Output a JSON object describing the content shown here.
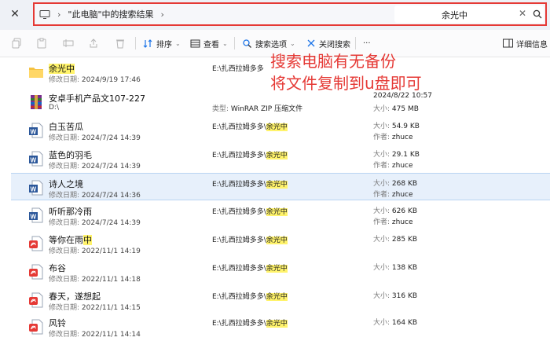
{
  "window": {
    "close_glyph": "✕"
  },
  "address": {
    "location": "\"此电脑\"中的搜索结果",
    "chevron": "›",
    "search_value": "余光中",
    "clear_glyph": "✕"
  },
  "toolbar": {
    "sort_label": "排序",
    "view_label": "查看",
    "search_options_label": "搜索选项",
    "close_search_label": "关闭搜索",
    "more_label": "···",
    "details_label": "详细信息"
  },
  "annotation": {
    "line1": "搜索电脑有无备份",
    "line2": "将文件复制到u盘即可"
  },
  "files": [
    {
      "kind": "folder",
      "name_pre": "",
      "name_hl": "余光中",
      "name_post": "",
      "date_label": "修改日期:",
      "date": "2024/9/19 17:46",
      "path_pre": "E:\\扎西拉姆多多",
      "path_hl": "",
      "type_label": "",
      "type_value": "",
      "c1_label": "",
      "c1_value": "",
      "c2_label": "",
      "c2_value": ""
    },
    {
      "kind": "rar",
      "name_pre": "安卓手机产品文107-227",
      "name_hl": "",
      "name_post": "",
      "date_label": "",
      "date": "D:\\",
      "path_pre": "",
      "path_hl": "",
      "type_label": "类型:",
      "type_value": "WinRAR ZIP 压缩文件",
      "c1_label": "",
      "c1_value": "2024/8/22 10:57",
      "c2_label": "大小:",
      "c2_value": "475 MB"
    },
    {
      "kind": "word",
      "name_pre": "白玉苦瓜",
      "name_hl": "",
      "name_post": "",
      "date_label": "修改日期:",
      "date": "2024/7/24 14:39",
      "path_pre": "E:\\扎西拉姆多多\\",
      "path_hl": "余光中",
      "type_label": "",
      "type_value": "",
      "c1_label": "大小:",
      "c1_value": "54.9 KB",
      "c2_label": "作者:",
      "c2_value": "zhuce"
    },
    {
      "kind": "word",
      "name_pre": "蓝色的羽毛",
      "name_hl": "",
      "name_post": "",
      "date_label": "修改日期:",
      "date": "2024/7/24 14:39",
      "path_pre": "E:\\扎西拉姆多多\\",
      "path_hl": "余光中",
      "type_label": "",
      "type_value": "",
      "c1_label": "大小:",
      "c1_value": "29.1 KB",
      "c2_label": "作者:",
      "c2_value": "zhuce"
    },
    {
      "kind": "word",
      "name_pre": "诗人之境",
      "name_hl": "",
      "name_post": "",
      "date_label": "修改日期:",
      "date": "2024/7/24 14:36",
      "path_pre": "E:\\扎西拉姆多多\\",
      "path_hl": "余光中",
      "type_label": "",
      "type_value": "",
      "c1_label": "大小:",
      "c1_value": "268 KB",
      "c2_label": "作者:",
      "c2_value": "zhuce"
    },
    {
      "kind": "word",
      "name_pre": "听听那冷雨",
      "name_hl": "",
      "name_post": "",
      "date_label": "修改日期:",
      "date": "2024/7/24 14:39",
      "path_pre": "E:\\扎西拉姆多多\\",
      "path_hl": "余光中",
      "type_label": "",
      "type_value": "",
      "c1_label": "大小:",
      "c1_value": "626 KB",
      "c2_label": "作者:",
      "c2_value": "zhuce"
    },
    {
      "kind": "pdf",
      "name_pre": "等你在雨",
      "name_hl": "中",
      "name_post": "",
      "date_label": "修改日期:",
      "date": "2022/11/1 14:19",
      "path_pre": "E:\\扎西拉姆多多\\",
      "path_hl": "余光中",
      "type_label": "",
      "type_value": "",
      "c1_label": "大小:",
      "c1_value": "285 KB",
      "c2_label": "",
      "c2_value": ""
    },
    {
      "kind": "pdf",
      "name_pre": "布谷",
      "name_hl": "",
      "name_post": "",
      "date_label": "修改日期:",
      "date": "2022/11/1 14:18",
      "path_pre": "E:\\扎西拉姆多多\\",
      "path_hl": "余光中",
      "type_label": "",
      "type_value": "",
      "c1_label": "大小:",
      "c1_value": "138 KB",
      "c2_label": "",
      "c2_value": ""
    },
    {
      "kind": "pdf",
      "name_pre": "春天，遂想起",
      "name_hl": "",
      "name_post": "",
      "date_label": "修改日期:",
      "date": "2022/11/1 14:15",
      "path_pre": "E:\\扎西拉姆多多\\",
      "path_hl": "余光中",
      "type_label": "",
      "type_value": "",
      "c1_label": "大小:",
      "c1_value": "316 KB",
      "c2_label": "",
      "c2_value": ""
    },
    {
      "kind": "pdf",
      "name_pre": "风铃",
      "name_hl": "",
      "name_post": "",
      "date_label": "修改日期:",
      "date": "2022/11/1 14:14",
      "path_pre": "E:\\扎西拉姆多多\\",
      "path_hl": "余光中",
      "type_label": "",
      "type_value": "",
      "c1_label": "大小:",
      "c1_value": "164 KB",
      "c2_label": "",
      "c2_value": ""
    }
  ],
  "selected_index": 4,
  "colors": {
    "accent": "#1a73e8",
    "annotation": "#e53935",
    "highlight": "#fff36b",
    "selection": "#e7f0fb"
  }
}
